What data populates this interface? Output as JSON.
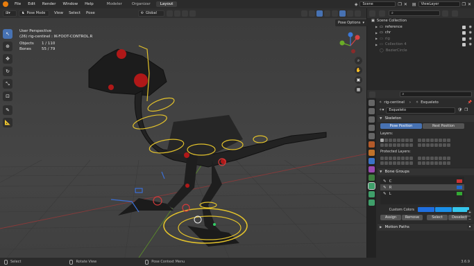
{
  "topbar": {
    "menus": [
      "File",
      "Edit",
      "Render",
      "Window",
      "Help"
    ],
    "workspaces": [
      "Modeler",
      "Organizar",
      "Layout"
    ],
    "active_workspace": "Layout",
    "scene": "Scene",
    "view_layer": "ViewLayer"
  },
  "viewport_header": {
    "mode": "Pose Mode",
    "menus": [
      "View",
      "Select",
      "Pose"
    ],
    "transform_orientation": "Global",
    "pose_options": "Pose Options"
  },
  "viewport_info": {
    "view_name": "User Perspective",
    "object_context": "(26) rig-centinel : IK-FOOT-CONTROL.R",
    "objects_label": "Objects",
    "objects_value": "1 / 110",
    "bones_label": "Bones",
    "bones_value": "55 / 79"
  },
  "outliner": {
    "title": "Scene Collection",
    "items": [
      {
        "label": "reference",
        "dim": false
      },
      {
        "label": "chr",
        "dim": false
      },
      {
        "label": "rig",
        "dim": true
      },
      {
        "label": "Collection 4",
        "dim": true
      },
      {
        "label": "BezierCircle",
        "dim": true
      }
    ]
  },
  "properties": {
    "object_name": "rig-centinel",
    "armature_name": "Esqueleto",
    "data_field": "Esqueleto",
    "skeleton_panel": "Skeleton",
    "pose_position": "Pose Position",
    "rest_position": "Rest Position",
    "layers_label": "Layers:",
    "protected_layers_label": "Protected Layers:",
    "bone_groups_panel": "Bone Groups",
    "bone_groups": [
      "C",
      "R",
      "L"
    ],
    "custom_colors_label": "Custom Colors",
    "custom_colors": [
      "#1f6fe0",
      "#1a8fe8",
      "#35c6ec"
    ],
    "assign": "Assign",
    "remove": "Remove",
    "select": "Select",
    "deselect": "Deselect",
    "motion_paths_panel": "Motion Paths"
  },
  "statusbar": {
    "select": "Select",
    "rotate_view": "Rotate View",
    "context_menu": "Pose Context Menu",
    "version": "3.6.9"
  }
}
